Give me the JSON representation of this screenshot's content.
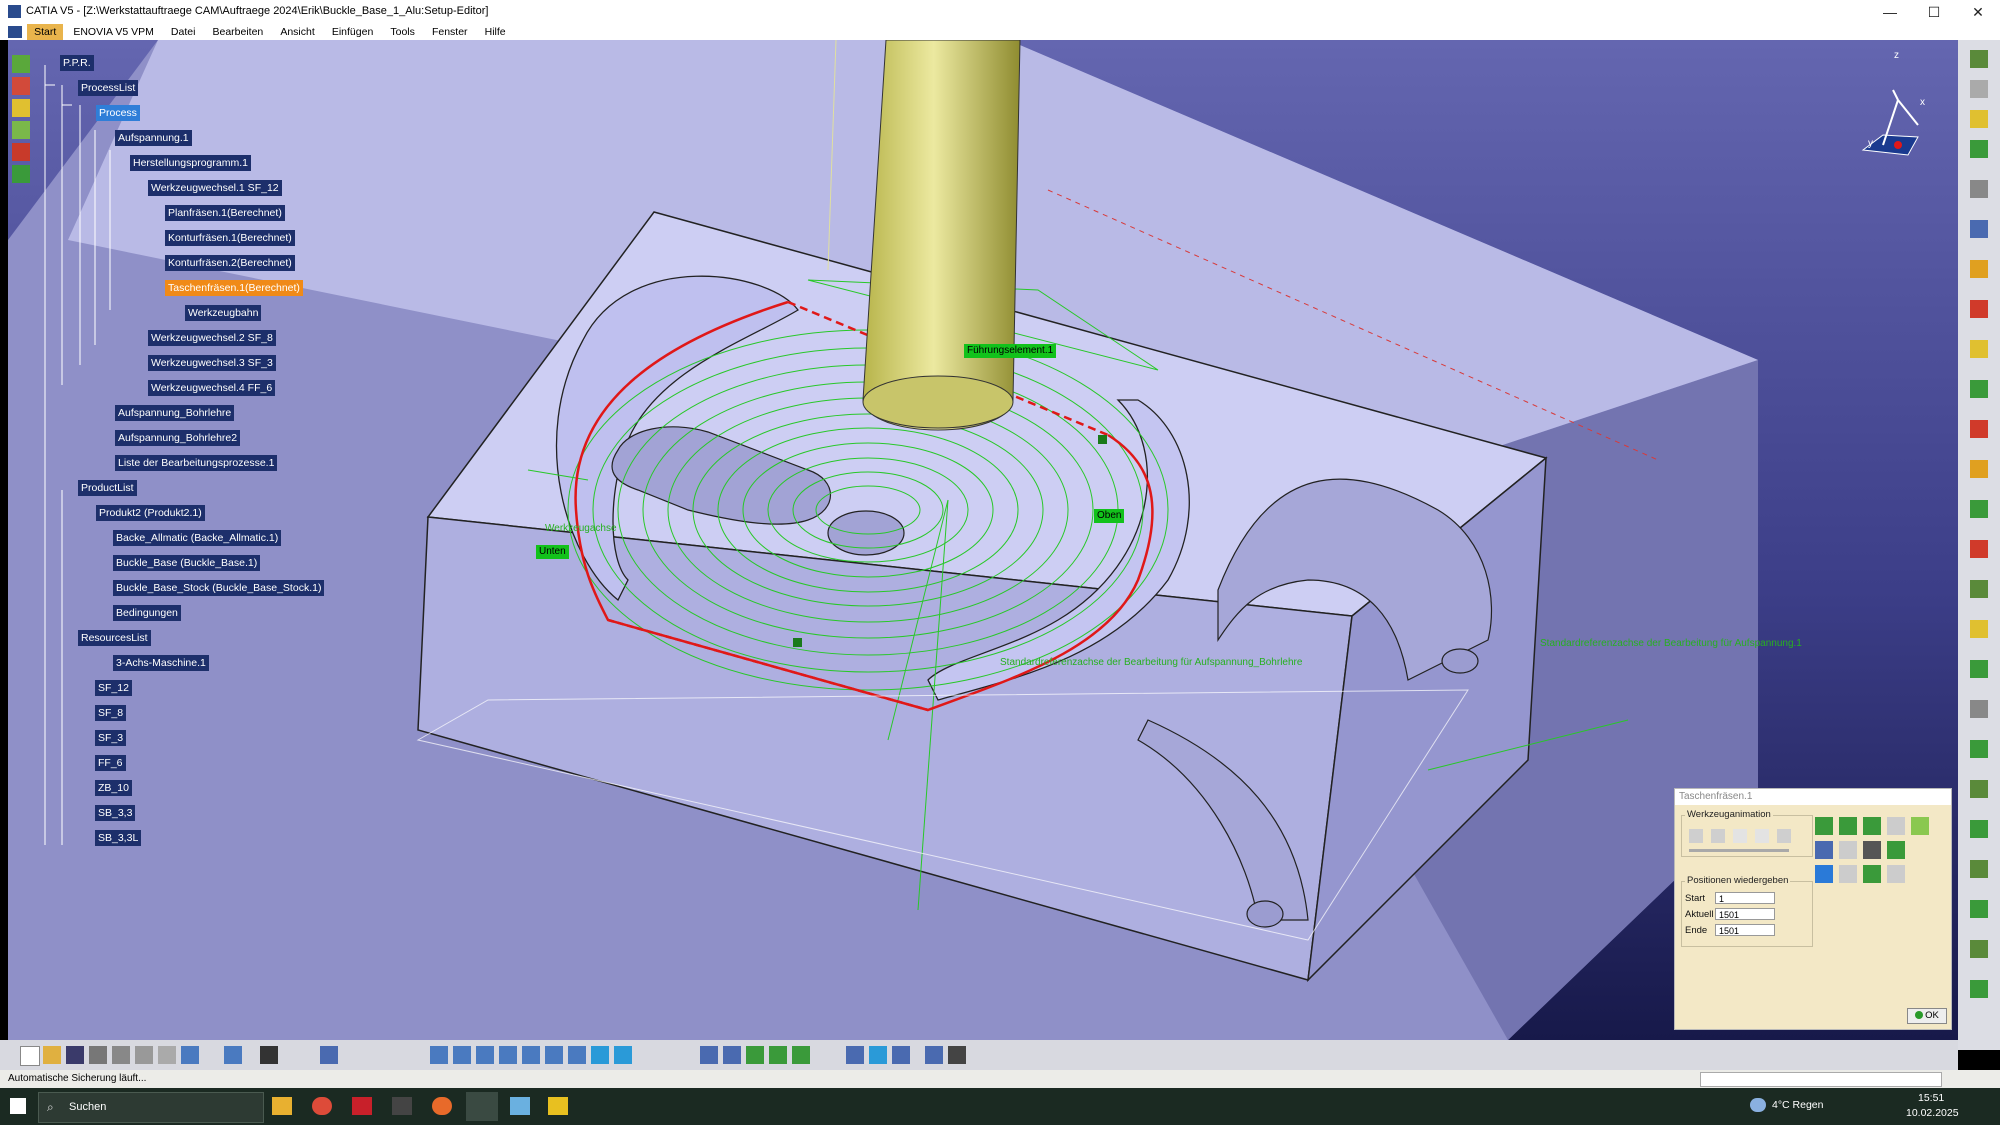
{
  "window": {
    "title": "CATIA V5 - [Z:\\Werkstattauftraege CAM\\Auftraege 2024\\Erik\\Buckle_Base_1_Alu:Setup-Editor]",
    "controls": [
      "—",
      "☐",
      "✕"
    ]
  },
  "menu": [
    "Start",
    "ENOVIA V5 VPM",
    "Datei",
    "Bearbeiten",
    "Ansicht",
    "Einfügen",
    "Tools",
    "Fenster",
    "Hilfe"
  ],
  "tree": {
    "root": "P.P.R.",
    "processlist": "ProcessList",
    "process": "Process",
    "aufspannung1": "Aufspannung.1",
    "programm": "Herstellungsprogramm.1",
    "wzw1": "Werkzeugwechsel.1  SF_12",
    "op1": "Planfräsen.1(Berechnet)",
    "op2": "Konturfräsen.1(Berechnet)",
    "op3": "Konturfräsen.2(Berechnet)",
    "op4": "Taschenfräsen.1(Berechnet)",
    "werkzeugbahn": "Werkzeugbahn",
    "wzw2": "Werkzeugwechsel.2  SF_8",
    "wzw3": "Werkzeugwechsel.3  SF_3",
    "wzw4": "Werkzeugwechsel.4  FF_6",
    "aufsp_bohr": "Aufspannung_Bohrlehre",
    "aufsp_bohr2": "Aufspannung_Bohrlehre2",
    "liste": "Liste der Bearbeitungsprozesse.1",
    "productlist": "ProductList",
    "produkt2": "Produkt2 (Produkt2.1)",
    "backe": "Backe_Allmatic (Backe_Allmatic.1)",
    "buckle": "Buckle_Base (Buckle_Base.1)",
    "buckle_stock": "Buckle_Base_Stock (Buckle_Base_Stock.1)",
    "bedingungen": "Bedingungen",
    "resourceslist": "ResourcesList",
    "maschine": "3-Achs-Maschine.1",
    "tools": [
      "SF_12",
      "SF_8",
      "SF_3",
      "FF_6",
      "ZB_10",
      "SB_3,3",
      "SB_3,3L"
    ]
  },
  "viewport": {
    "labels": {
      "fuehrung": "Führungselement.1",
      "oben": "Oben",
      "unten": "Unten",
      "werkzeugachse": "Werkzeugachse",
      "ref1": "Standardreferenzachse der Bearbeitung für Aufspannung.1",
      "ref2": "Standardreferenzachse der Bearbeitung für Aufspannung_Bohrlehre"
    },
    "compass": {
      "x": "x",
      "y": "y",
      "z": "z"
    },
    "colors": {
      "bg_top": "#5b5da8",
      "bg_bottom": "#1b1d52",
      "part": "#c8c9f0",
      "toolpath": "#28c828",
      "contour": "#e01818",
      "tool": "#d9d771"
    }
  },
  "panel": {
    "title": "Taschenfräsen.1",
    "group1": "Werkzeuganimation",
    "group2": "Positionen wiedergeben",
    "start_label": "Start",
    "start_value": "1",
    "aktuell_label": "Aktuell",
    "aktuell_value": "1501",
    "ende_label": "Ende",
    "ende_value": "1501",
    "ok": "OK"
  },
  "status": {
    "text": "Automatische Sicherung läuft..."
  },
  "taskbar": {
    "search": "Suchen",
    "weather": "4°C  Regen",
    "time": "15:51",
    "date": "10.02.2025"
  }
}
